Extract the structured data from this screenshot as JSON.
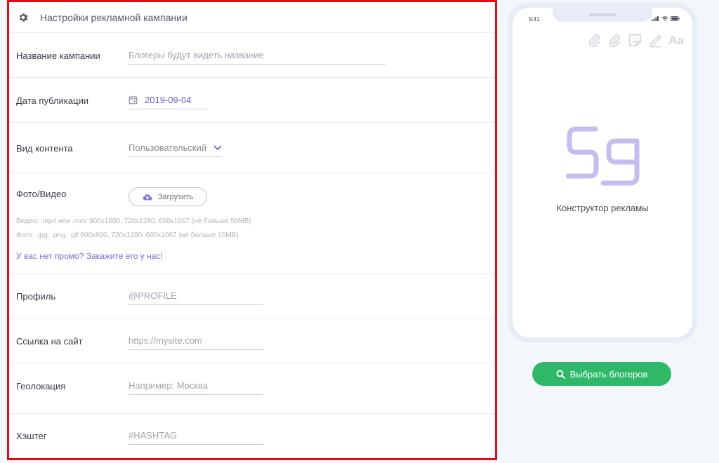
{
  "form": {
    "title": "Настройки рекламной кампании",
    "campaign_name": {
      "label": "Название кампании",
      "placeholder": "Блогеры будут видеть название"
    },
    "publish_date": {
      "label": "Дата публикации",
      "value": "2019-09-04"
    },
    "content_type": {
      "label": "Вид контента",
      "value": "Пользовательский"
    },
    "media": {
      "label": "Фото/Видео",
      "upload_label": "Загрузить",
      "hint_video": "Видео: .mp4 или .mov 900x1600, 720x1280, 600x1067 (не больше 50MB)",
      "hint_photo": "Фото:  .jpg, .png, .gif 600x600, 720x1280, 600x1067 (не больше 10MB)",
      "promo_link": "У вас нет промо? Закажите его у нас!"
    },
    "profile": {
      "label": "Профиль",
      "placeholder": "@PROFILE"
    },
    "site_link": {
      "label": "Ссылка на сайт",
      "placeholder": "https://mysite.com"
    },
    "geolocation": {
      "label": "Геолокация",
      "placeholder": "Например: Москва"
    },
    "hashtag": {
      "label": "Хэштег",
      "placeholder": "#HASHTAG"
    }
  },
  "phone": {
    "time": "9:41",
    "tool_text": "Aa",
    "tools": [
      "paperclip-icon",
      "paperclip-icon",
      "sticker-icon",
      "pen-icon"
    ],
    "caption": "Конструктор рекламы"
  },
  "actions": {
    "select_bloggers": "Выбрать блогеров"
  },
  "colors": {
    "accent": "#6c5ccf",
    "link": "#7b6bd6",
    "primary_button": "#2eb867",
    "frame_highlight": "#dd0f14"
  }
}
